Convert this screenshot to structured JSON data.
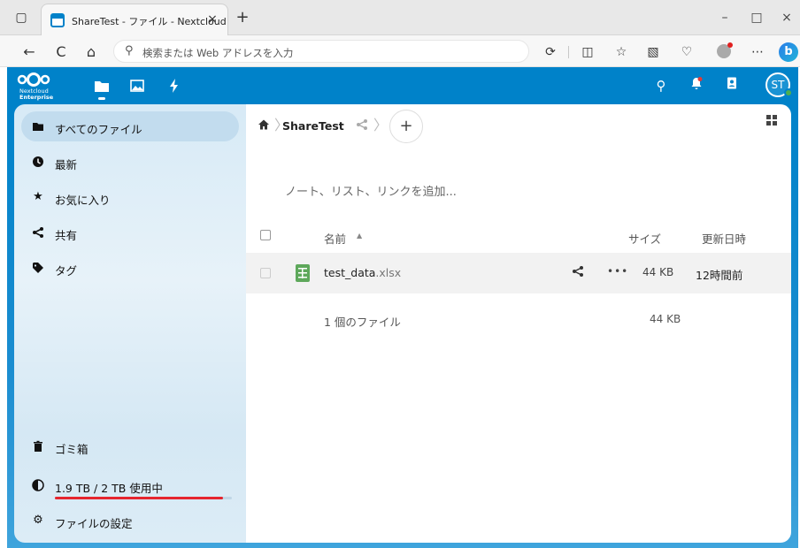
{
  "browser": {
    "tab_title": "ShareTest - ファイル - Nextcloud",
    "tab_close": "×",
    "new_tab": "+",
    "window_controls": {
      "minimize": "–",
      "maximize": "□",
      "close": "×"
    },
    "address_placeholder": "検索または Web アドレスを入力",
    "nav": {
      "back": "←",
      "reload": "C",
      "home": "⌂"
    },
    "more": "⋯",
    "copilot": "b"
  },
  "nextcloud": {
    "logo_line1": "Nextcloud",
    "logo_line2": "Enterprise",
    "avatar_initials": "ST",
    "brand_color": "#0082c9"
  },
  "sidebar": {
    "items": [
      {
        "label": "すべてのファイル",
        "icon": "folder-icon",
        "active": true
      },
      {
        "label": "最新",
        "icon": "clock-icon",
        "active": false
      },
      {
        "label": "お気に入り",
        "icon": "star-icon",
        "active": false
      },
      {
        "label": "共有",
        "icon": "share-icon",
        "active": false
      },
      {
        "label": "タグ",
        "icon": "tag-icon",
        "active": false
      }
    ],
    "trash": "ゴミ箱",
    "quota": "1.9 TB / 2 TB 使用中",
    "quota_fraction": 0.95,
    "settings": "ファイルの設定"
  },
  "content": {
    "breadcrumb": {
      "folder": "ShareTest"
    },
    "add_button": "+",
    "rich_workspace_placeholder": "ノート、リスト、リンクを追加...",
    "columns": {
      "name": "名前",
      "size": "サイズ",
      "modified": "更新日時"
    },
    "files": [
      {
        "name": "test_data",
        "ext": ".xlsx",
        "size": "44 KB",
        "modified": "12時間前",
        "icon": "spreadsheet-icon"
      }
    ],
    "summary": {
      "count": "1 個のファイル",
      "size": "44 KB"
    }
  }
}
